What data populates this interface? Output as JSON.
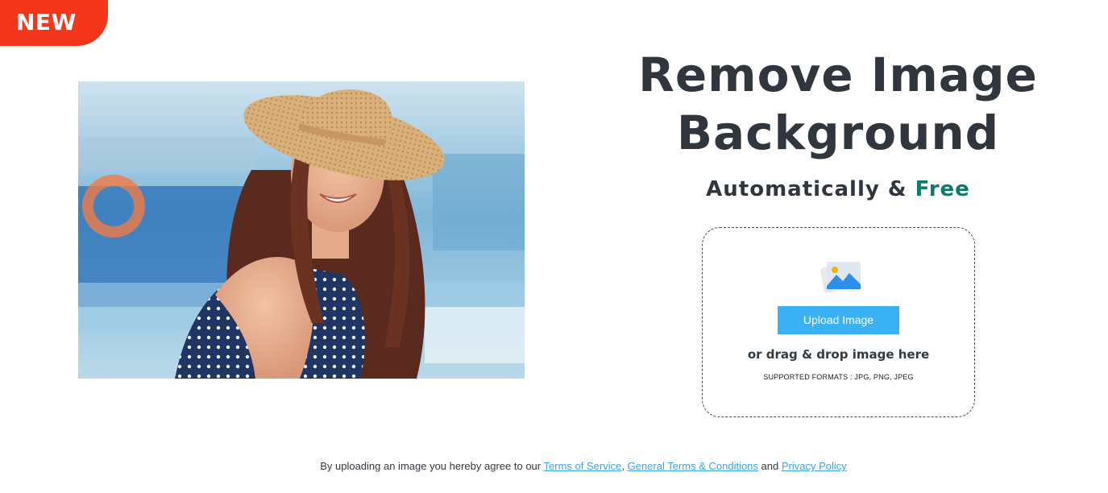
{
  "badge": {
    "label": "NEW"
  },
  "hero": {
    "title_line1": "Remove Image",
    "title_line2": "Background",
    "subtitle_prefix": "Automatically",
    "subtitle_amp": "&",
    "subtitle_free": "Free"
  },
  "uploader": {
    "icon": "image-icon",
    "button_label": "Upload Image",
    "drag_text": "or drag & drop image here",
    "formats_text": "SUPPORTED FORMATS : JPG, PNG, JPEG"
  },
  "footer": {
    "prefix": "By uploading an image you hereby agree to our",
    "terms_link": "Terms of Service",
    "sep1": ",",
    "general_terms_link": "General Terms & Conditions",
    "and": "and",
    "privacy_link": "Privacy Policy"
  },
  "colors": {
    "badge": "#f4361b",
    "heading": "#2f363d",
    "accent_free": "#0f7a6b",
    "button": "#3bb1f5",
    "link": "#3aa4e6"
  }
}
